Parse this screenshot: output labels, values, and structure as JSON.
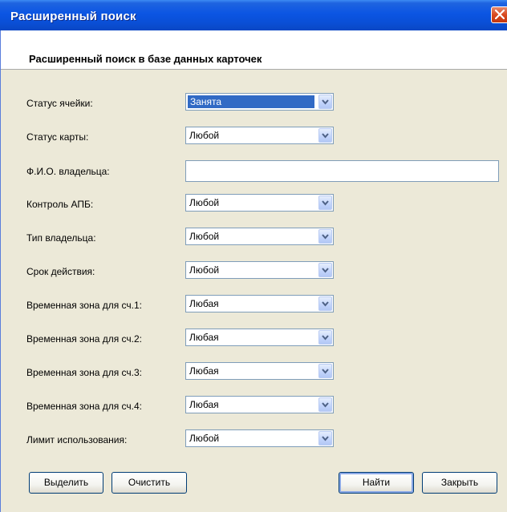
{
  "window": {
    "title": "Расширенный поиск",
    "header_title": "Расширенный поиск в базе данных карточек"
  },
  "fields": {
    "cell_status": {
      "label": "Статус ячейки:",
      "value": "Занята"
    },
    "card_status": {
      "label": "Статус карты:",
      "value": "Любой"
    },
    "owner_name": {
      "label": "Ф.И.О. владельца:",
      "value": ""
    },
    "apb_control": {
      "label": "Контроль АПБ:",
      "value": "Любой"
    },
    "owner_type": {
      "label": "Тип владельца:",
      "value": "Любой"
    },
    "validity": {
      "label": "Срок действия:",
      "value": "Любой"
    },
    "tz1": {
      "label": "Временная зона для сч.1:",
      "value": "Любая"
    },
    "tz2": {
      "label": "Временная зона для сч.2:",
      "value": "Любая"
    },
    "tz3": {
      "label": "Временная зона для сч.3:",
      "value": "Любая"
    },
    "tz4": {
      "label": "Временная зона для сч.4:",
      "value": "Любая"
    },
    "usage_limit": {
      "label": "Лимит использования:",
      "value": "Любой"
    }
  },
  "buttons": {
    "select": "Выделить",
    "clear": "Очистить",
    "find": "Найти",
    "close": "Закрыть"
  },
  "colors": {
    "titlebar": "#0a4fd6",
    "dialog_bg": "#ece9d8",
    "selection": "#316ac5",
    "close": "#d9491f"
  }
}
